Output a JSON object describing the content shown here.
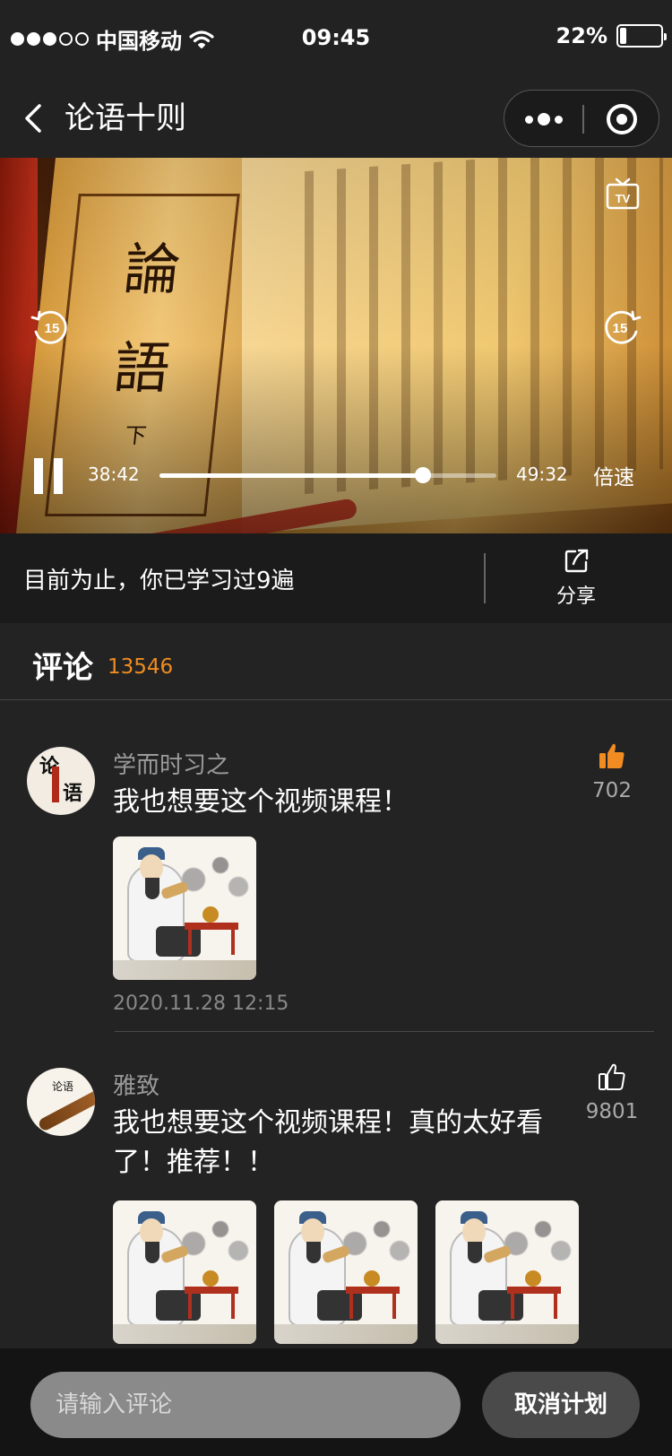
{
  "status_bar": {
    "carrier": "中国移动",
    "time": "09:45",
    "battery_percent": "22%",
    "battery_level": 0.22,
    "signal_bars_filled": 3,
    "signal_bars_total": 5
  },
  "nav": {
    "title": "论语十则",
    "icons": {
      "back": "chevron-left-icon",
      "more": "more-dots-icon",
      "close": "target-ring-icon"
    }
  },
  "video": {
    "current_time": "38:42",
    "total_time": "49:32",
    "progress": 0.781,
    "speed_label": "倍速",
    "skip_back_seconds": "15",
    "skip_forward_seconds": "15",
    "tv_label": "TV",
    "cover_chars": [
      "論",
      "語",
      "下"
    ]
  },
  "study": {
    "text": "目前为止，你已学习过9遍",
    "share_label": "分享"
  },
  "comments": {
    "title": "评论",
    "count": "13546",
    "items": [
      {
        "username": "学而时习之",
        "text": "我也想要这个视频课程！",
        "likes": "702",
        "liked": true,
        "time": "2020.11.28   12:15",
        "avatar_text": [
          "论",
          "语"
        ]
      },
      {
        "username": "雅致",
        "text": "我也想要这个视频课程！真的太好看了！推荐！！",
        "likes": "9801",
        "liked": false,
        "avatar_text": [
          "论语"
        ]
      }
    ]
  },
  "colors": {
    "accent": "#f08c21",
    "background": "#232323",
    "bar": "#1b1b1b"
  },
  "bottom": {
    "input_placeholder": "请输入评论",
    "cancel_label": "取消计划"
  }
}
